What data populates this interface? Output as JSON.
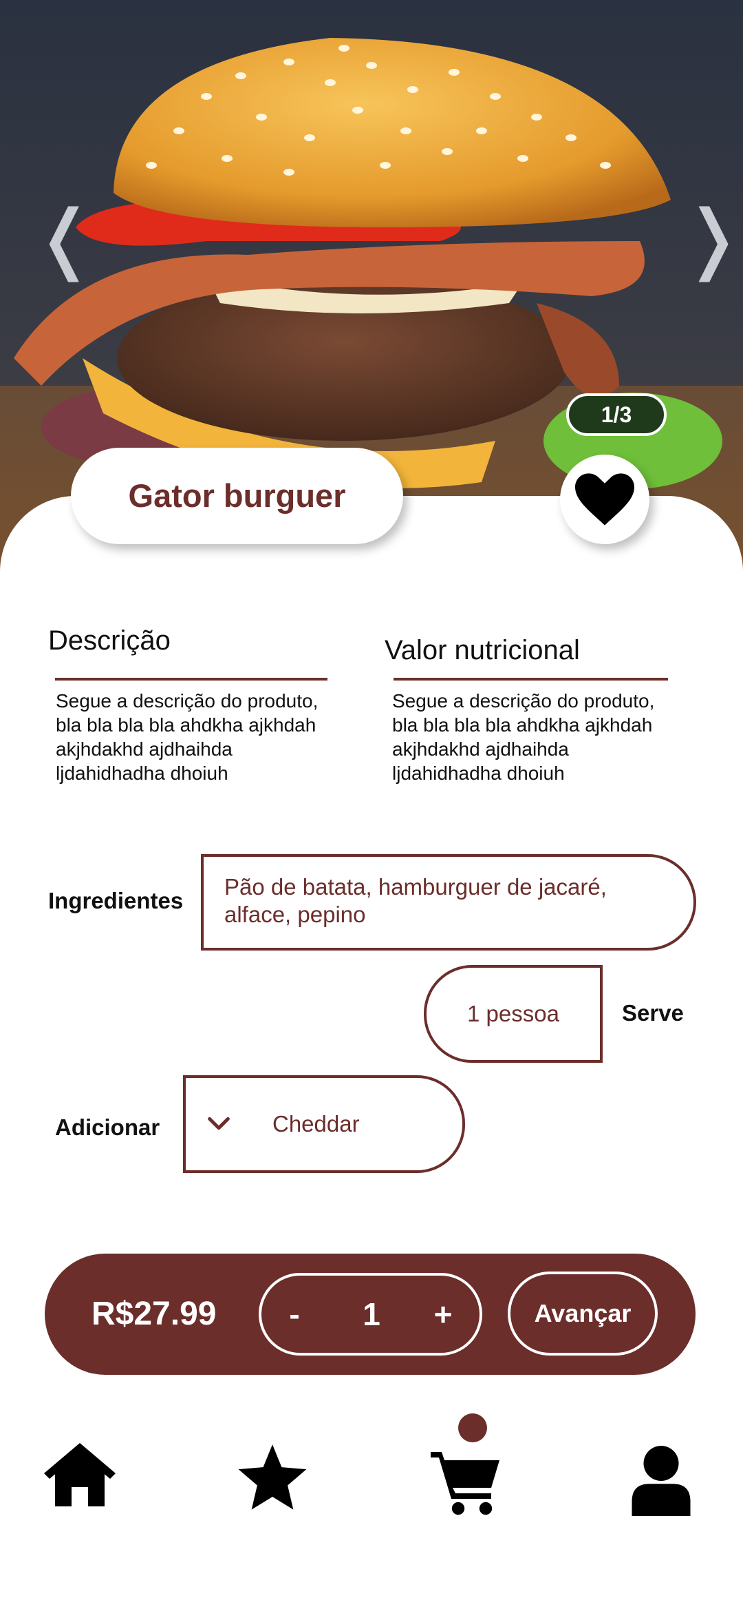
{
  "product": {
    "title": "Gator burguer",
    "image_counter": "1/3"
  },
  "carousel": {
    "prev_icon": "chevron-left-icon",
    "next_icon": "chevron-right-icon"
  },
  "sections": {
    "description": {
      "title": "Descrição",
      "body": "Segue a descrição do produto, bla bla bla bla ahdkha ajkhdah akjhdakhd ajdhaihda ljdahidhadha dhoiuh"
    },
    "nutrition": {
      "title": "Valor nutricional",
      "body": "Segue a descrição do produto, bla bla bla bla ahdkha ajkhdah akjhdakhd ajdhaihda ljdahidhadha dhoiuh"
    }
  },
  "ingredients": {
    "label": "Ingredientes",
    "value": "Pão de batata, hamburguer de jacaré, alface, pepino"
  },
  "serves": {
    "label": "Serve",
    "value": "1 pessoa"
  },
  "addon": {
    "label": "Adicionar",
    "selected": "Cheddar"
  },
  "order": {
    "price": "R$27.99",
    "minus": "-",
    "quantity": "1",
    "plus": "+",
    "next_label": "Avançar"
  },
  "tabbar": {
    "items": [
      {
        "icon": "home-icon"
      },
      {
        "icon": "star-icon"
      },
      {
        "icon": "cart-icon"
      },
      {
        "icon": "user-icon"
      }
    ]
  },
  "colors": {
    "brand": "#6b2e2b",
    "background": "#ffffff",
    "counter_bg": "#1f3a1b"
  }
}
